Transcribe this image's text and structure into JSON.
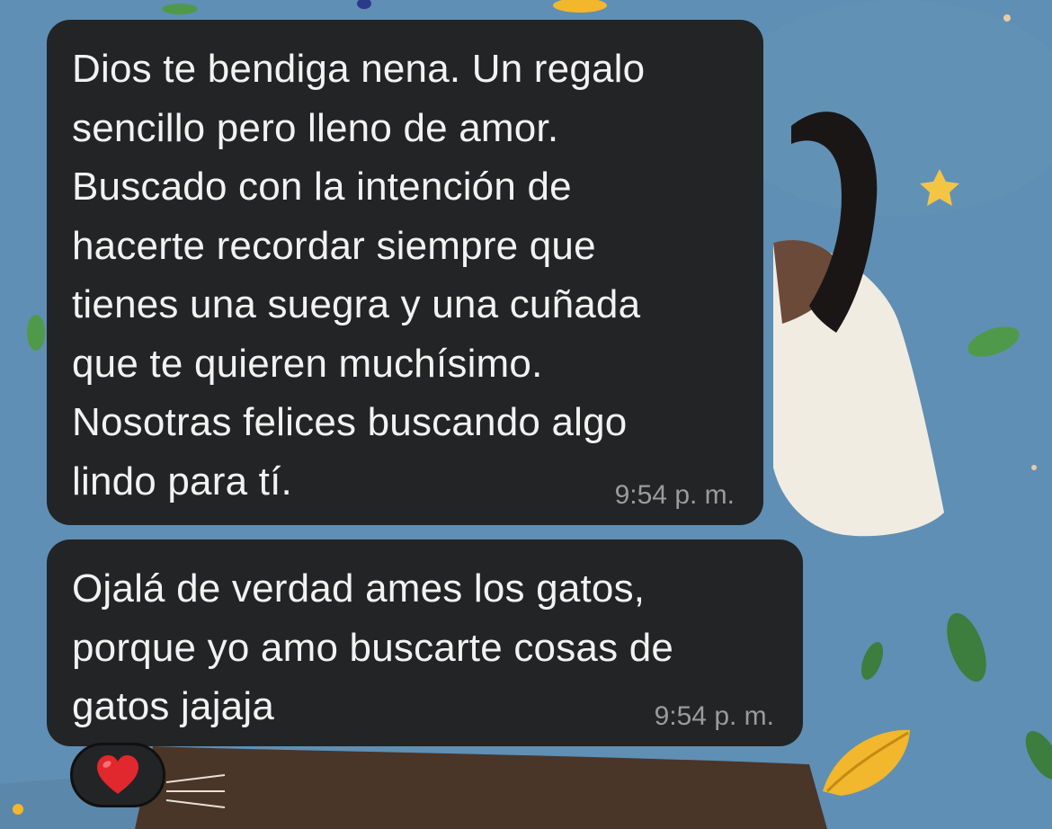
{
  "chat": {
    "messages": [
      {
        "text": "Dios te bendiga nena. Un regalo\nsencillo pero lleno de amor.\nBuscado con la intención de\nhacerte recordar siempre que\ntienes una suegra y una cuñada\nque te quieren muchísimo.\nNosotras felices buscando algo\nlindo para tí.",
        "time": "9:54 p. m."
      },
      {
        "text": "Ojalá de verdad ames los gatos,\nporque yo amo buscarte cosas de\ngatos jajaja",
        "time": "9:54 p. m."
      }
    ],
    "reaction": {
      "icon": "red-heart-icon",
      "color": "#e0282e"
    }
  },
  "colors": {
    "bubble": "#232425",
    "text": "#f2f2f2",
    "timestamp": "#9a9b9d",
    "wallpaper": "#5f8fb4"
  }
}
